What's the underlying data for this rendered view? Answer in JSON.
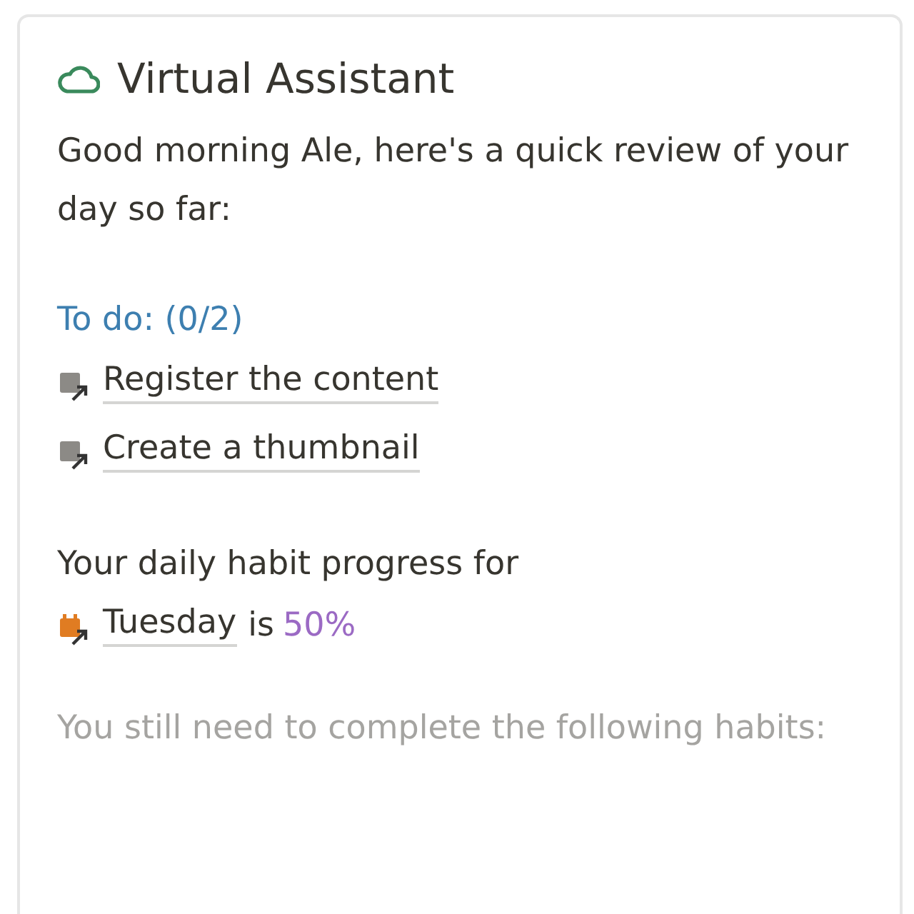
{
  "card": {
    "title": "Virtual Assistant",
    "greeting": "Good morning Ale, here's a quick review of your day so far:",
    "todo_heading": "To do: (0/2)",
    "todos": [
      {
        "label": "Register the content"
      },
      {
        "label": "Create a thumbnail"
      }
    ],
    "habit_intro": "Your daily habit progress for",
    "habit_day": "Tuesday",
    "habit_connector": "is",
    "habit_percent": "50%",
    "remaining_note": "You still need to complete the following habits:"
  }
}
